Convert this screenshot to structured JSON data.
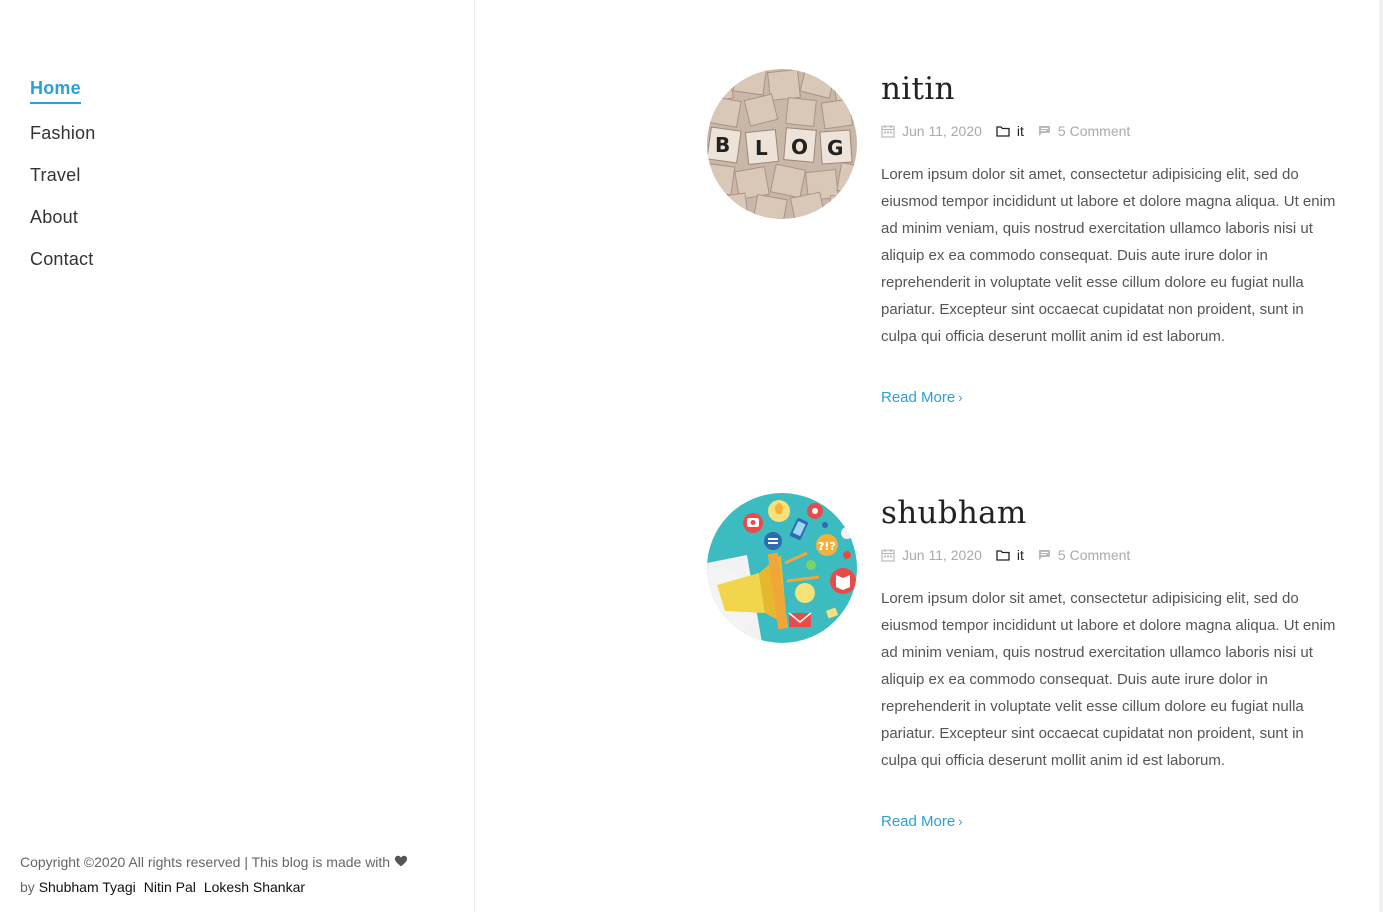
{
  "nav": {
    "items": [
      {
        "label": "Home"
      },
      {
        "label": "Fashion"
      },
      {
        "label": "Travel"
      },
      {
        "label": "About"
      },
      {
        "label": "Contact"
      }
    ]
  },
  "footer": {
    "copyright": "Copyright ©2020 All rights reserved | This blog is made with",
    "by": "by",
    "authors": [
      "Shubham Tyagi",
      "Nitin Pal",
      "Lokesh Shankar"
    ],
    "heart_icon": "heart-icon"
  },
  "posts": [
    {
      "title": "nitin",
      "date": "Jun 11, 2020",
      "category": "it",
      "comments": "5 Comment",
      "excerpt": "Lorem ipsum dolor sit amet, consectetur adipisicing elit, sed do eiusmod tempor incididunt ut labore et dolore magna aliqua. Ut enim ad minim veniam, quis nostrud exercitation ullamco laboris nisi ut aliquip ex ea commodo consequat. Duis aute irure dolor in reprehenderit in voluptate velit esse cillum dolore eu fugiat nulla pariatur. Excepteur sint occaecat cupidatat non proident, sunt in culpa qui officia deserunt mollit anim id est laborum.",
      "read_more": "Read More",
      "tiles": [
        "B",
        "L",
        "O",
        "G"
      ]
    },
    {
      "title": "shubham",
      "date": "Jun 11, 2020",
      "category": "it",
      "comments": "5 Comment",
      "excerpt": "Lorem ipsum dolor sit amet, consectetur adipisicing elit, sed do eiusmod tempor incididunt ut labore et dolore magna aliqua. Ut enim ad minim veniam, quis nostrud exercitation ullamco laboris nisi ut aliquip ex ea commodo consequat. Duis aute irure dolor in reprehenderit in voluptate velit esse cillum dolore eu fugiat nulla pariatur. Excepteur sint occaecat cupidatat non proident, sunt in culpa qui officia deserunt mollit anim id est laborum.",
      "read_more": "Read More",
      "tile_text": "?!?"
    }
  ],
  "colors": {
    "accent": "#2aa0d8",
    "text": "#555555",
    "meta": "#aaaaaa"
  }
}
